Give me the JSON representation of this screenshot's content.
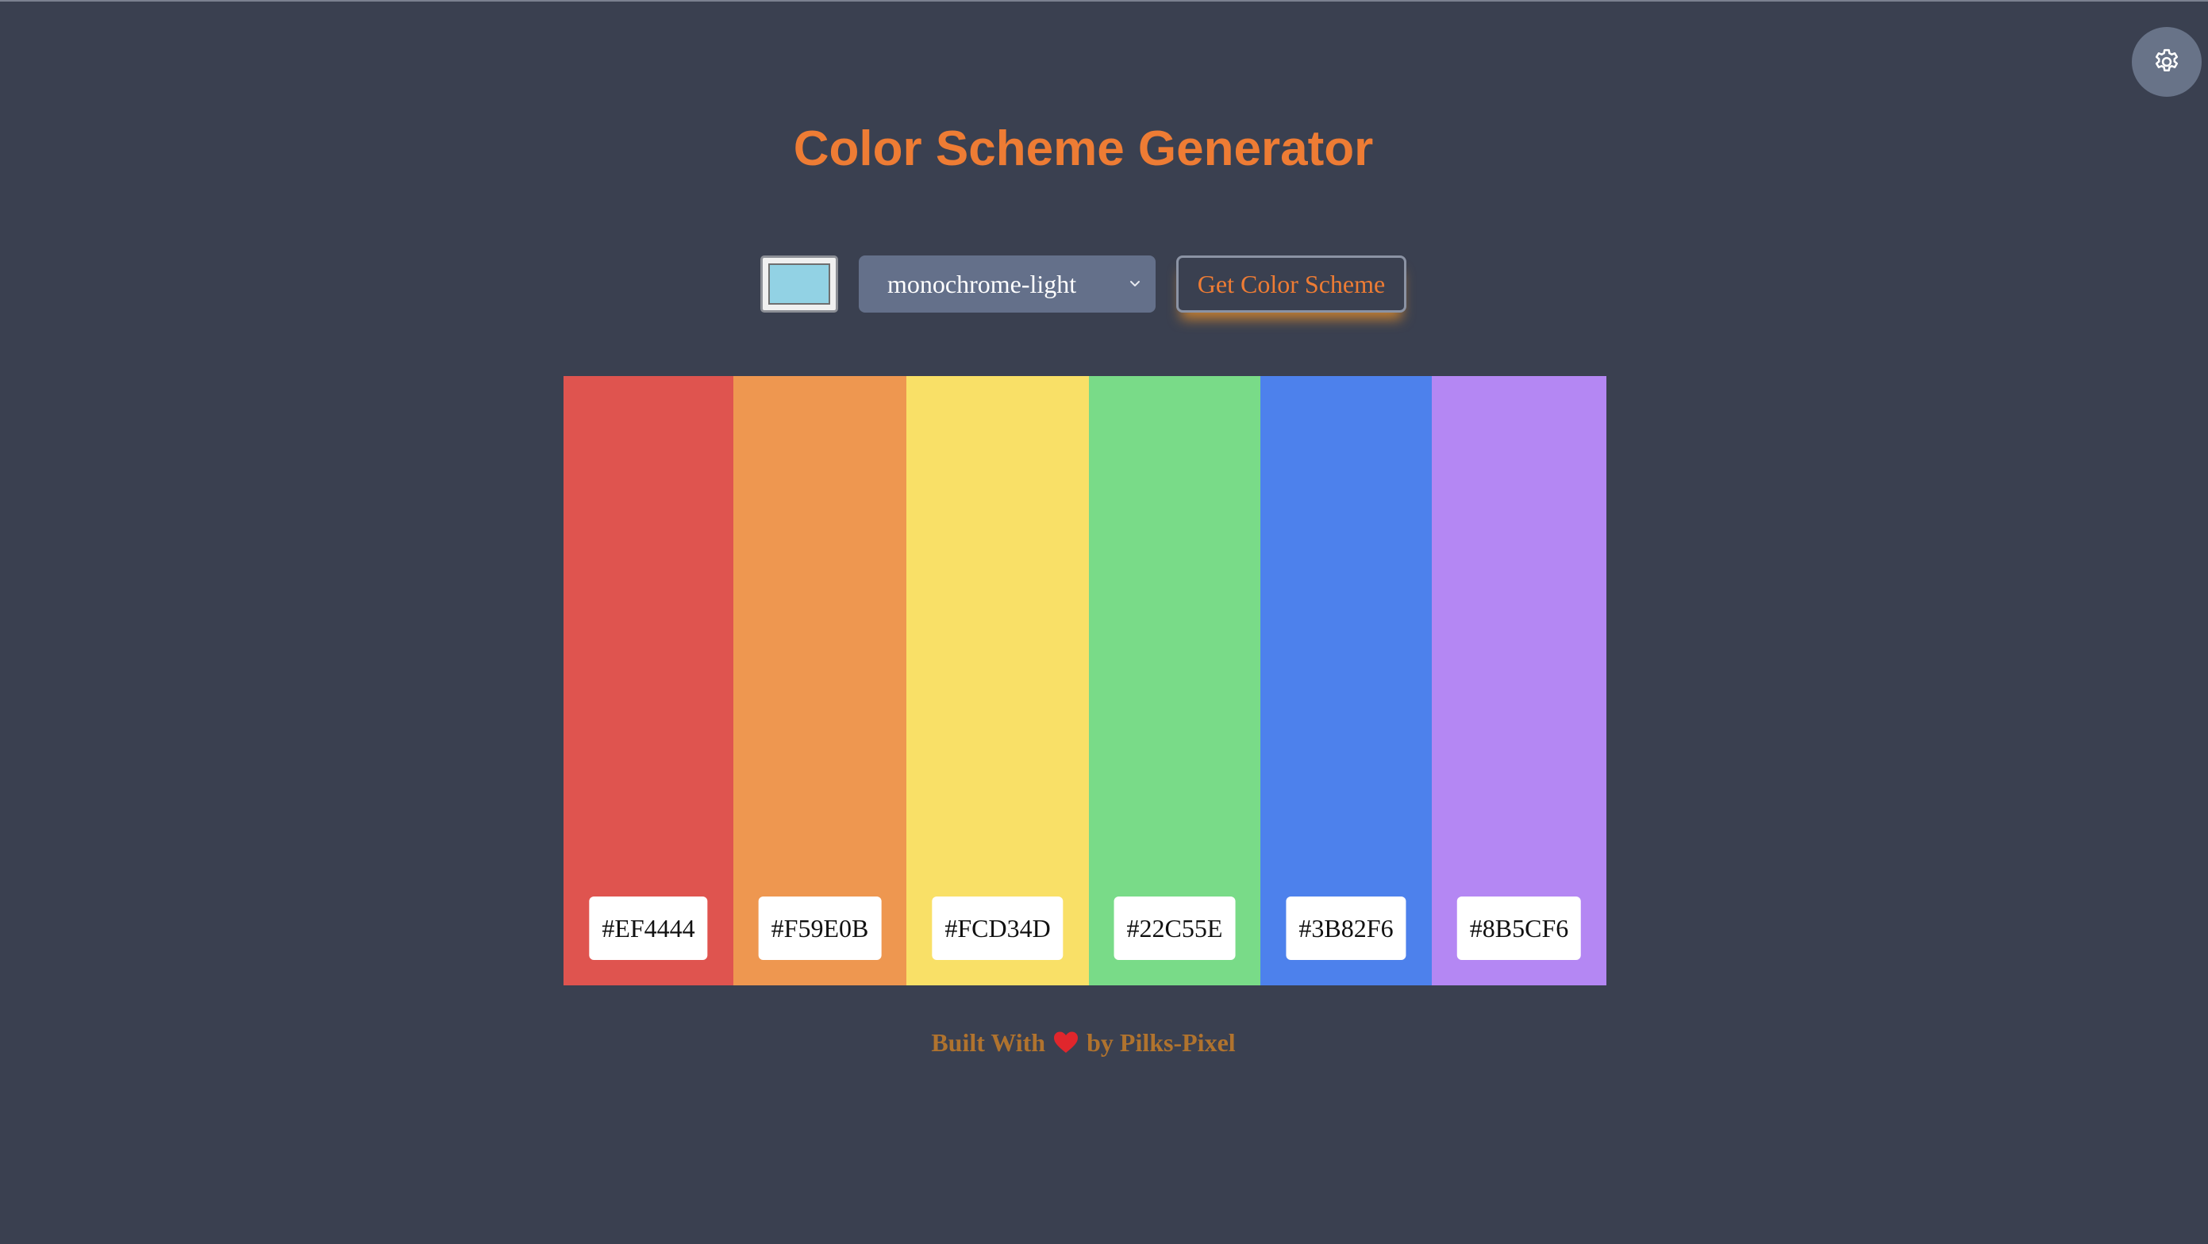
{
  "page": {
    "title": "Color Scheme Generator",
    "background": "#3a4050",
    "accent": "#ee7c34"
  },
  "settings": {
    "icon": "gear-icon"
  },
  "controls": {
    "seed_color": "#92d2e4",
    "mode_value": "monochrome-light",
    "button_label": "Get Color Scheme"
  },
  "palette": [
    {
      "hex": "#EF4444",
      "display_color": "#df544f"
    },
    {
      "hex": "#F59E0B",
      "display_color": "#ee9750"
    },
    {
      "hex": "#FCD34D",
      "display_color": "#f9e067"
    },
    {
      "hex": "#22C55E",
      "display_color": "#79db88"
    },
    {
      "hex": "#3B82F6",
      "display_color": "#4d81ec"
    },
    {
      "hex": "#8B5CF6",
      "display_color": "#b487f3"
    }
  ],
  "footer": {
    "prefix": "Built With",
    "heart_icon": "heart-icon",
    "suffix": "by Pilks-Pixel",
    "color": "#b0732e"
  }
}
